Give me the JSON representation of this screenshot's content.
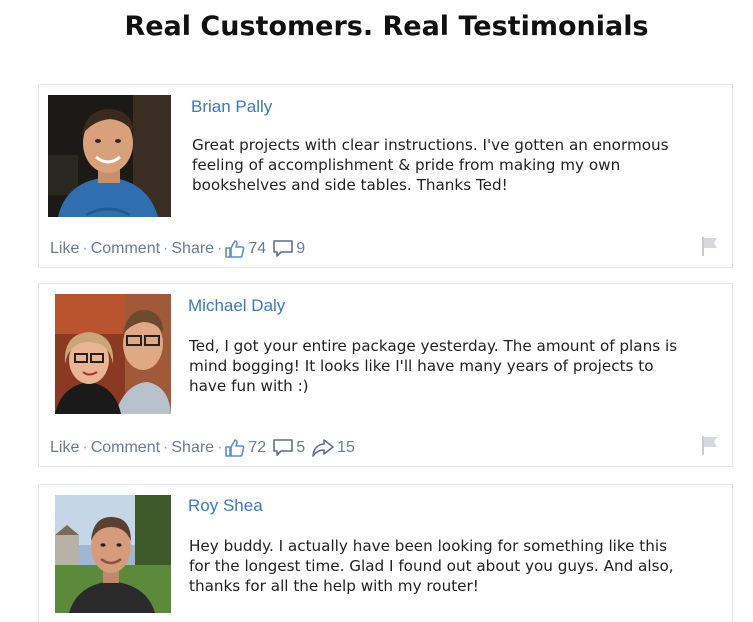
{
  "page": {
    "title": "Real Customers. Real Testimonials"
  },
  "colors": {
    "author_link": "#3b78c2",
    "action_link": "#6b7c93",
    "card_border": "#e3e6ea"
  },
  "testimonials": [
    {
      "author": "Brian Pally",
      "quote": "Great projects with clear instructions. I've gotten an enormous\nfeeling of accomplishment & pride from making my own\nbookshelves and side tables. Thanks Ted!",
      "actions": {
        "like": "Like",
        "comment": "Comment",
        "share": "Share",
        "sep": "·"
      },
      "likes": "74",
      "comments": "9",
      "shares": "",
      "icons": [
        "thumbs-up-icon",
        "comment-bubble-icon",
        "flag-icon"
      ]
    },
    {
      "author": "Michael Daly",
      "quote": "Ted, I got your entire package yesterday. The amount of plans is\nmind bogging! It looks like I'll have many years of projects to\nhave fun with :)",
      "actions": {
        "like": "Like",
        "comment": "Comment",
        "share": "Share",
        "sep": "·"
      },
      "likes": "72",
      "comments": "5",
      "shares": "15",
      "icons": [
        "thumbs-up-icon",
        "comment-bubble-icon",
        "share-arrow-icon",
        "flag-icon"
      ]
    },
    {
      "author": "Roy Shea",
      "quote": "Hey buddy. I actually have been looking for something like this\nfor the longest time. Glad I found out about you guys. And also,\nthanks for all the help with my router!",
      "icons": []
    }
  ]
}
